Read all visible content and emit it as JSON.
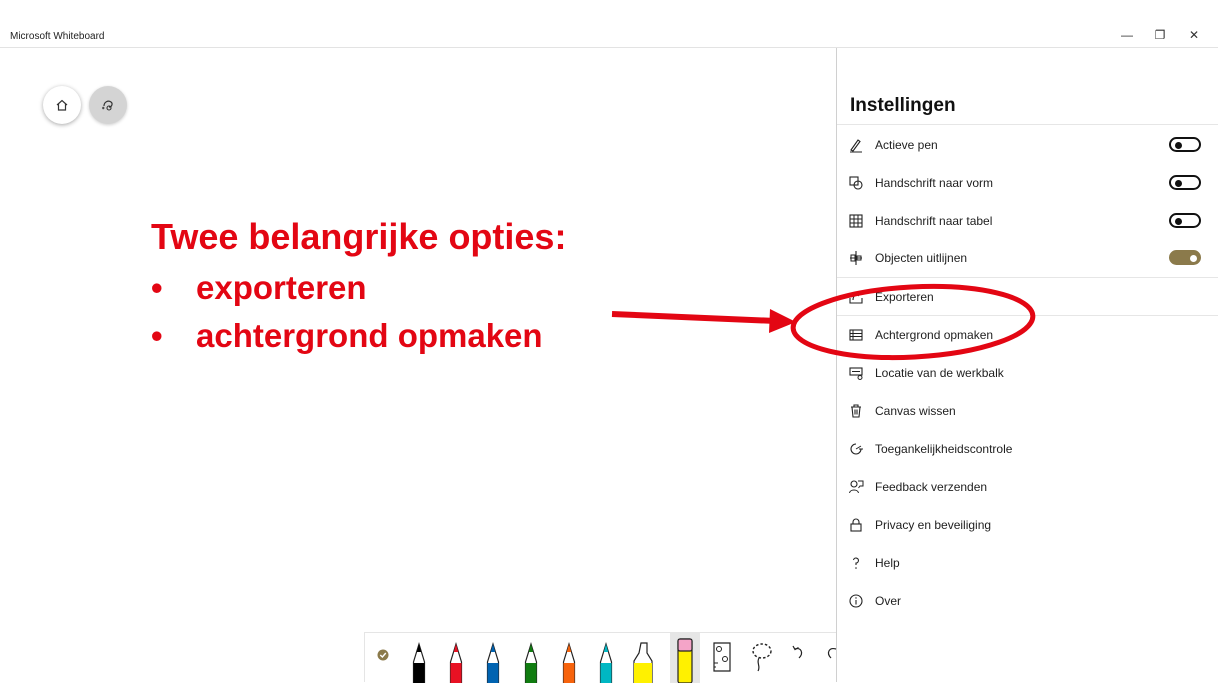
{
  "window": {
    "title": "Microsoft Whiteboard",
    "controls": [
      "minimize-icon",
      "restore-icon",
      "close-icon"
    ],
    "minimize_glyph": "—",
    "restore_glyph": "❐",
    "close_glyph": "✕"
  },
  "canvas": {
    "nav_buttons": [
      "home-icon",
      "invite-icon"
    ],
    "annotation": {
      "heading": "Twee belangrijke opties:",
      "bullets": [
        "exporteren",
        "achtergrond opmaken"
      ],
      "bullet_char": "•",
      "color": "#e30613"
    }
  },
  "settings": {
    "title": "Instellingen",
    "toggles": [
      {
        "icon": "pen-icon",
        "label": "Actieve pen",
        "on": false
      },
      {
        "icon": "shapes-icon",
        "label": "Handschrift naar vorm",
        "on": false
      },
      {
        "icon": "table-icon",
        "label": "Handschrift naar tabel",
        "on": false
      },
      {
        "icon": "align-icon",
        "label": "Objecten uitlijnen",
        "on": true
      }
    ],
    "items": [
      {
        "icon": "export-icon",
        "label": "Exporteren"
      },
      {
        "icon": "background-icon",
        "label": "Achtergrond opmaken"
      },
      {
        "icon": "toolbar-location-icon",
        "label": "Locatie van de werkbalk"
      },
      {
        "icon": "trash-icon",
        "label": "Canvas wissen"
      },
      {
        "icon": "accessibility-icon",
        "label": "Toegankelijkheidscontrole"
      },
      {
        "icon": "feedback-icon",
        "label": "Feedback verzenden"
      },
      {
        "icon": "lock-icon",
        "label": "Privacy en beveiliging"
      },
      {
        "icon": "help-icon",
        "label": "Help"
      },
      {
        "icon": "info-icon",
        "label": "Over"
      }
    ],
    "toggle_on_color": "#8b7a4b"
  },
  "toolbar": {
    "tools": [
      {
        "icon": "finish-check-icon",
        "color": "#8b7a4b"
      },
      {
        "icon": "pen-black-icon",
        "color": "#000000"
      },
      {
        "icon": "pen-red-icon",
        "color": "#e81123"
      },
      {
        "icon": "pen-blue-icon",
        "color": "#0063b1"
      },
      {
        "icon": "pen-green-icon",
        "color": "#107c10"
      },
      {
        "icon": "pen-orange-icon",
        "color": "#f7630c"
      },
      {
        "icon": "pen-teal-icon",
        "color": "#00b7c3"
      },
      {
        "icon": "highlighter-yellow-icon",
        "color": "#fff100"
      },
      {
        "icon": "eraser-icon",
        "color": "#f4a4c8",
        "selected": true
      },
      {
        "icon": "ruler-icon",
        "color": "#333333"
      },
      {
        "icon": "lasso-icon",
        "color": "#333333"
      },
      {
        "icon": "undo-icon",
        "color": "#333333"
      },
      {
        "icon": "redo-icon",
        "color": "#333333"
      }
    ]
  }
}
